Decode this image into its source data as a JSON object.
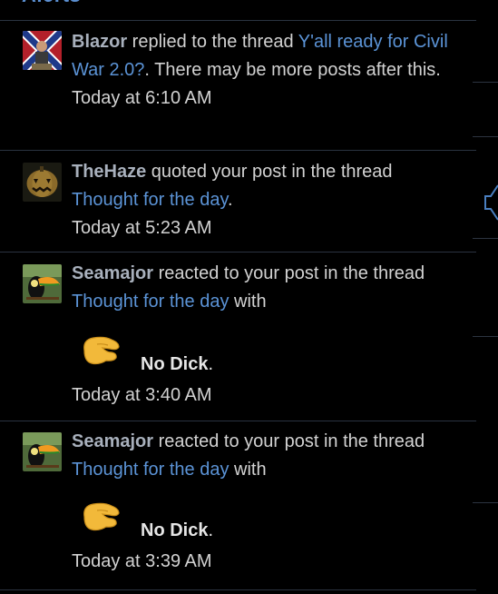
{
  "header": {
    "title": "Alerts"
  },
  "alerts": [
    {
      "user": "Blazor",
      "action": " replied to the thread ",
      "thread": "Y'all ready for Civil War 2.0?",
      "suffix": ". There may be more posts after this.",
      "time": "Today at 6:10 AM",
      "avatar_icon": "confederate-flag-avatar-icon"
    },
    {
      "user": "TheHaze",
      "action": " quoted your post in the thread ",
      "thread": "Thought for the day",
      "suffix": ".",
      "time": "Today at 5:23 AM",
      "avatar_icon": "pumpkin-avatar-icon"
    },
    {
      "user": "Seamajor",
      "action": " reacted to your post in the thread ",
      "thread": "Thought for the day",
      "suffix": " with",
      "reaction": "No Dick",
      "reaction_suffix": ".",
      "time": "Today at 3:40 AM",
      "avatar_icon": "toucan-avatar-icon"
    },
    {
      "user": "Seamajor",
      "action": " reacted to your post in the thread ",
      "thread": "Thought for the day",
      "suffix": " with",
      "reaction": "No Dick",
      "reaction_suffix": ".",
      "time": "Today at 3:39 AM",
      "avatar_icon": "toucan-avatar-icon"
    }
  ],
  "colors": {
    "background": "#000000",
    "link": "#5b93d6",
    "username": "#a8b0bc",
    "divider": "#2a3340"
  }
}
